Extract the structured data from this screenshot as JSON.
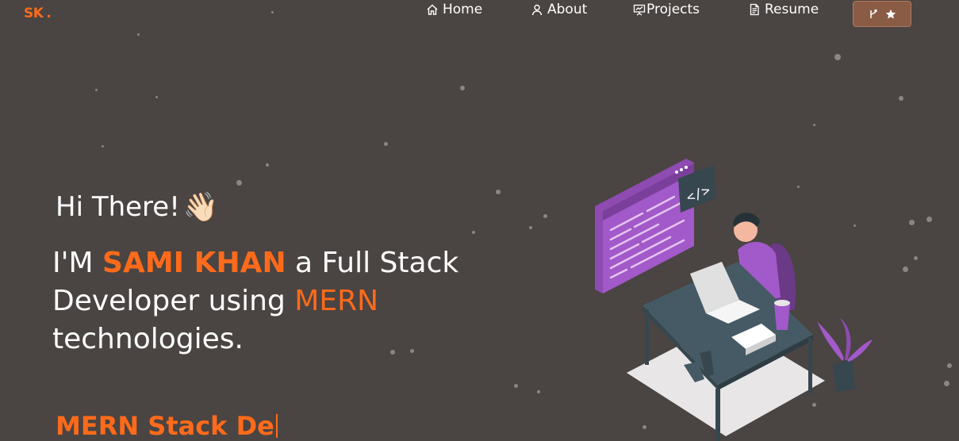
{
  "nav": {
    "logo": "SK",
    "logo_dot": ".",
    "items": [
      {
        "label": "Home",
        "icon": "home-icon"
      },
      {
        "label": "About",
        "icon": "user-icon"
      },
      {
        "label": "Projects",
        "icon": "presentation-icon"
      },
      {
        "label": "Resume",
        "icon": "document-icon"
      }
    ],
    "github_button": {
      "icons": [
        "git-fork-icon",
        "star-icon"
      ]
    }
  },
  "hero": {
    "greeting": "Hi There!",
    "wave_emoji": "👋🏻",
    "intro_prefix": "I'M ",
    "name": "SAMI KHAN",
    "intro_middle": " a Full Stack Developer using ",
    "tech": "MERN",
    "intro_suffix": " technologies.",
    "typed_text": "MERN Stack De"
  },
  "colors": {
    "background": "#4a4442",
    "accent": "#ff6b1a",
    "button_bg": "#8a5b45",
    "illustration_purple": "#a259c9"
  }
}
